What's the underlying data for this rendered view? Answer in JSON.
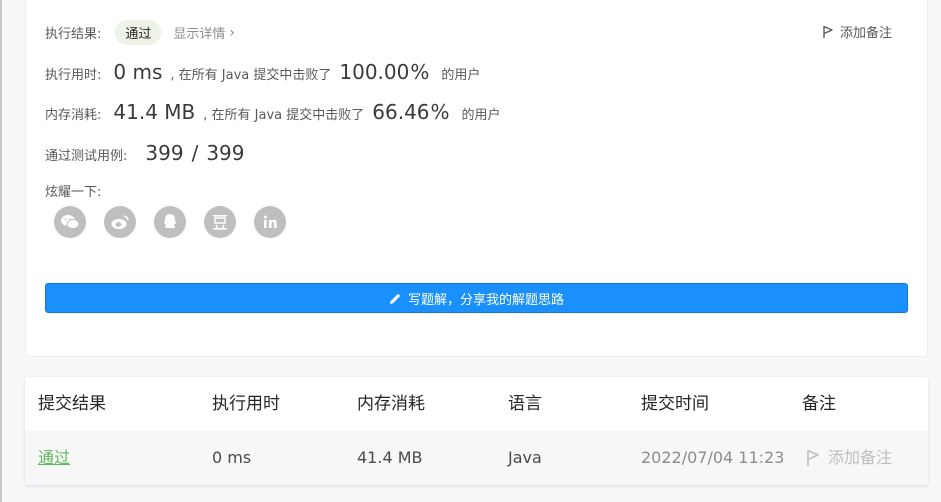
{
  "summary": {
    "result_label": "执行结果:",
    "result_value": "通过",
    "details_label": "显示详情",
    "add_note": "添加备注",
    "runtime_label": "执行用时:",
    "runtime_value": "0 ms",
    "runtime_beat_text": ", 在所有 Java 提交中击败了",
    "runtime_pct": "100.00",
    "memory_label": "内存消耗:",
    "memory_value": "41.4 MB",
    "memory_beat_text": ", 在所有 Java 提交中击败了",
    "memory_pct": "66.46",
    "pct_symbol": "%",
    "users_suffix": "的用户",
    "tests_label": "通过测试用例:",
    "tests_passed": "399",
    "tests_sep": "/",
    "tests_total": "399",
    "share_label": "炫耀一下:",
    "share_icons": [
      "wechat-icon",
      "weibo-icon",
      "qq-icon",
      "douban-icon",
      "linkedin-icon"
    ],
    "write_solution": "写题解，分享我的解题思路"
  },
  "table": {
    "headers": [
      "提交结果",
      "执行用时",
      "内存消耗",
      "语言",
      "提交时间",
      "备注"
    ],
    "row": {
      "result": "通过",
      "runtime": "0 ms",
      "memory": "41.4 MB",
      "language": "Java",
      "time": "2022/07/04 11:23",
      "note": "添加备注"
    }
  },
  "colors": {
    "primary": "#1a90ff",
    "pass_green": "#5cb85c",
    "badge_bg": "#eef3e8"
  }
}
